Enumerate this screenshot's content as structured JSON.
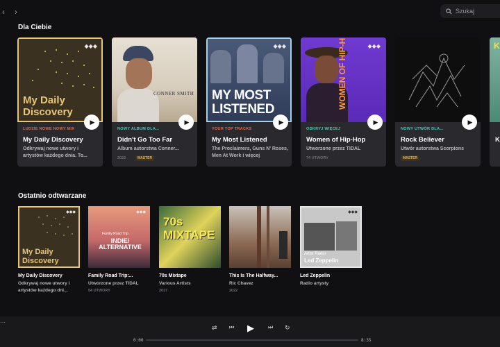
{
  "search": {
    "placeholder": "Szukaj"
  },
  "sections": {
    "for_you": "Dla Ciebie",
    "recent": "Ostatnio odtwarzane"
  },
  "big_cards": [
    {
      "tag": "Ludzie nowe nowy mix",
      "title": "My Daily Discovery",
      "subtitle": "Odkrywaj nowe utwory i artystów każdego dnia. To...",
      "meta": "",
      "badge": "",
      "tag_color": "#e06b4a",
      "art_text": "My Daily Discovery"
    },
    {
      "tag": "Nowy album dla...",
      "title": "Didn't Go Too Far",
      "subtitle": "Album autorstwa Conner...",
      "meta": "2022",
      "badge": "MASTER",
      "tag_color": "#3fd1b6",
      "art_text": "CONNER SMITH"
    },
    {
      "tag": "Your top tracks",
      "title": "My Most Listened",
      "subtitle": "The Proclaimers, Guns N' Roses, Men At Work i więcej",
      "meta": "",
      "badge": "",
      "tag_color": "#e06b4a",
      "art_text": "MY MOST LISTENED"
    },
    {
      "tag": "Odkryj więcej",
      "title": "Women of Hip-Hop",
      "subtitle": "Utworzone przez TIDAL",
      "meta": "74 UTWORY",
      "badge": "",
      "tag_color": "#3fd1b6",
      "art_text": "WOMEN OF HIP-HOP"
    },
    {
      "tag": "Nowy utwór dla...",
      "title": "Rock Believer",
      "subtitle": "Utwór autorstwa Scorpions",
      "meta": "",
      "badge": "MASTER",
      "tag_color": "#3fd1b6",
      "art_text": ""
    },
    {
      "tag": "",
      "title": "Ki",
      "subtitle": "",
      "meta": "",
      "badge": "",
      "tag_color": "#3fd1b6",
      "art_text": "Ki"
    }
  ],
  "recent_cards": [
    {
      "title": "My Daily Discovery",
      "subtitle": "Odkrywaj nowe utwory i artystów każdego dni...",
      "meta": "",
      "art_text": "My Daily Discovery"
    },
    {
      "title": "Family Road Trip:...",
      "subtitle": "Utworzone przez TIDAL",
      "meta": "54 UTWORY",
      "art_text": "INDIE/ ALTERNATIVE",
      "art_small": "Family Road Trip"
    },
    {
      "title": "70s Mixtape",
      "subtitle": "Various Artists",
      "meta": "2017",
      "art_text": "70s MIXTAPE"
    },
    {
      "title": "This Is The Halfway...",
      "subtitle": "Ric Chavez",
      "meta": "2022",
      "art_text": ""
    },
    {
      "title": "Led Zeppelin",
      "subtitle": "Radio artysty",
      "meta": "",
      "art_text": "Led Zeppelin",
      "art_small": "Artist Radio"
    }
  ],
  "player": {
    "time_elapsed": "0:00",
    "time_total": "8:35",
    "progress": 0.0
  },
  "colors": {
    "accent_gold": "#e8c777",
    "accent_teal": "#3fd1b6",
    "accent_orange": "#e06b4a"
  },
  "icons": [
    "back-icon",
    "forward-icon",
    "search-icon",
    "play-icon",
    "tidal-logo-icon",
    "shuffle-icon",
    "previous-icon",
    "next-icon",
    "repeat-icon",
    "more-icon"
  ]
}
